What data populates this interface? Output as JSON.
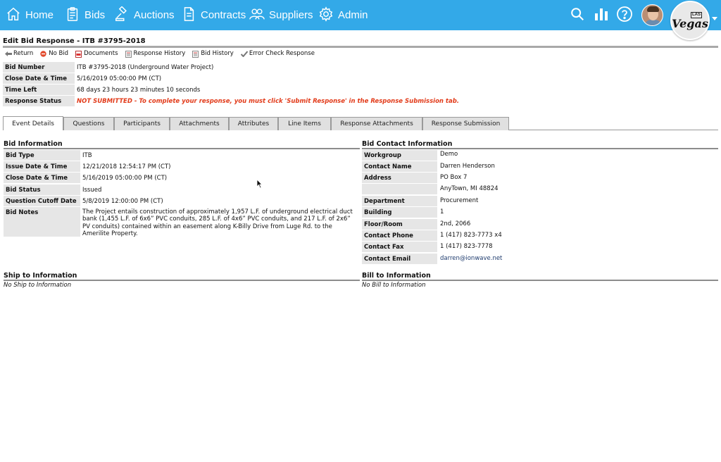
{
  "nav": {
    "items": [
      {
        "label": "Home",
        "icon": "home-icon"
      },
      {
        "label": "Bids",
        "icon": "clipboard-icon"
      },
      {
        "label": "Auctions",
        "icon": "gavel-icon"
      },
      {
        "label": "Contracts",
        "icon": "document-icon"
      },
      {
        "label": "Suppliers",
        "icon": "people-icon"
      },
      {
        "label": "Admin",
        "icon": "gear-icon"
      }
    ],
    "right_icons": [
      "search-icon",
      "chart-icon",
      "help-icon"
    ],
    "logo": {
      "small_text": "LAS",
      "big_text": "Vegas"
    },
    "colors": {
      "bar": "#33a9e8"
    }
  },
  "page": {
    "title": "Edit Bid Response - ITB #3795-2018"
  },
  "toolbar": {
    "items": [
      {
        "label": "Return",
        "icon": "arrow-left-icon"
      },
      {
        "label": "No Bid",
        "icon": "no-bid-icon"
      },
      {
        "label": "Documents",
        "icon": "pdf-icon"
      },
      {
        "label": "Response History",
        "icon": "history-doc-icon"
      },
      {
        "label": "Bid History",
        "icon": "history-doc-icon"
      },
      {
        "label": "Error Check Response",
        "icon": "checkmark-icon"
      }
    ]
  },
  "summary": {
    "rows": [
      {
        "label": "Bid Number",
        "value": "ITB #3795-2018 (Underground Water Project)"
      },
      {
        "label": "Close Date & Time",
        "value": "5/16/2019 05:00:00 PM (CT)"
      },
      {
        "label": "Time Left",
        "value": "68 days 23 hours 23 minutes 10 seconds"
      },
      {
        "label": "Response Status",
        "value": "NOT SUBMITTED - To complete your response, you must click 'Submit Response' in the Response Submission tab."
      }
    ],
    "status_color": "#e23b1a"
  },
  "tabs": [
    {
      "label": "Event Details",
      "active": true
    },
    {
      "label": "Questions"
    },
    {
      "label": "Participants"
    },
    {
      "label": "Attachments"
    },
    {
      "label": "Attributes"
    },
    {
      "label": "Line Items"
    },
    {
      "label": "Response Attachments"
    },
    {
      "label": "Response Submission"
    }
  ],
  "bid_information": {
    "heading": "Bid Information",
    "rows": [
      {
        "label": "Bid Type",
        "value": "ITB"
      },
      {
        "label": "Issue Date & Time",
        "value": "12/21/2018 12:54:17 PM (CT)"
      },
      {
        "label": "Close Date & Time",
        "value": "5/16/2019 05:00:00 PM (CT)"
      },
      {
        "label": "Bid Status",
        "value": "Issued"
      },
      {
        "label": "Question Cutoff Date",
        "value": "5/8/2019 12:00:00 PM (CT)"
      },
      {
        "label": "Bid Notes",
        "value": "The Project entails construction of approximately 1,957 L.F. of underground electrical duct bank (1,455 L.F. of 6x6” PVC conduits, 285 L.F. of 4x6” PVC conduits, and 217 L.F. of 2x6” PV conduits) contained within an easement along K-Billy Drive from Luge Rd. to the Amerilite Property."
      }
    ]
  },
  "bid_contact": {
    "heading": "Bid Contact Information",
    "rows": [
      {
        "label": "Workgroup",
        "value": "Demo"
      },
      {
        "label": "Contact Name",
        "value": "Darren Henderson"
      },
      {
        "label": "Address",
        "value": "PO Box 7"
      },
      {
        "label": "",
        "value": "AnyTown, MI 48824"
      },
      {
        "label": "Department",
        "value": "Procurement"
      },
      {
        "label": "Building",
        "value": "1"
      },
      {
        "label": "Floor/Room",
        "value": "2nd, 2066"
      },
      {
        "label": "Contact Phone",
        "value": "1 (417) 823-7773 x4"
      },
      {
        "label": "Contact Fax",
        "value": "1 (417) 823-7778"
      },
      {
        "label": "Contact Email",
        "value": "darren@ionwave.net"
      }
    ]
  },
  "ship_to": {
    "heading": "Ship to Information",
    "note": "No Ship to Information"
  },
  "bill_to": {
    "heading": "Bill to Information",
    "note": "No Bill to Information"
  }
}
